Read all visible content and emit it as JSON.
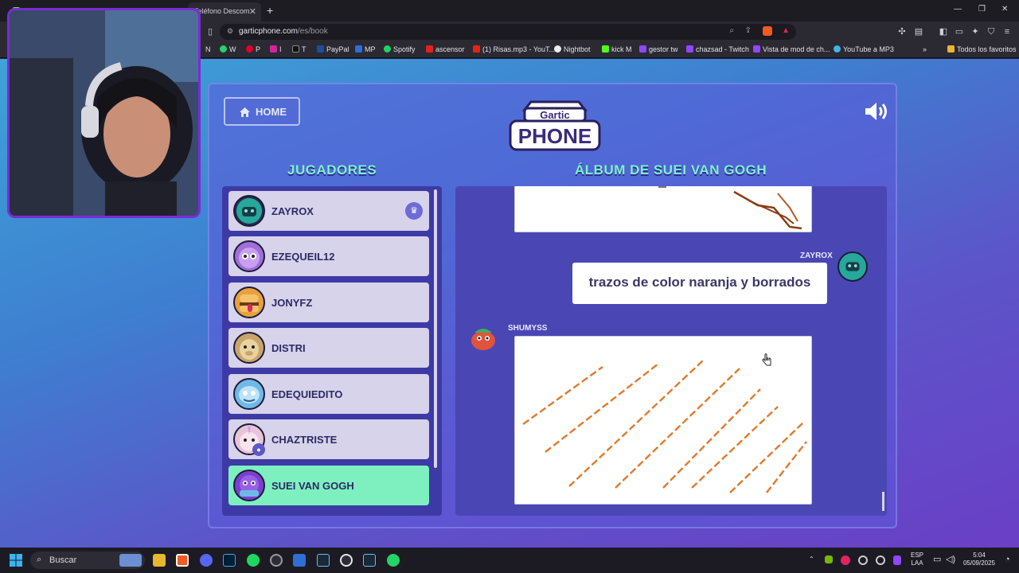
{
  "browser": {
    "tab_label": "Teléfono Descom",
    "url_domain": "garticphone.com",
    "url_path": "/es/book",
    "bookmarks": [
      {
        "label": "N"
      },
      {
        "label": "W"
      },
      {
        "label": "P"
      },
      {
        "label": "I"
      },
      {
        "label": "T"
      },
      {
        "label": "PayPal"
      },
      {
        "label": "MP"
      },
      {
        "label": "Spotify"
      },
      {
        "label": "ascensor"
      },
      {
        "label": "(1) Risas.mp3 - YouT..."
      },
      {
        "label": "Nightbot"
      },
      {
        "label": "kick M"
      },
      {
        "label": "gestor tw"
      },
      {
        "label": "chazsad - Twitch"
      },
      {
        "label": "Vista de mod de ch..."
      },
      {
        "label": "YouTube a MP3"
      },
      {
        "label": "Todos los favoritos"
      }
    ]
  },
  "game": {
    "home_label": "HOME",
    "logo_top": "Gartic",
    "logo_main": "PHONE",
    "players_title": "JUGADORES",
    "album_title": "ÁLBUM DE SUEI VAN GOGH",
    "players": [
      {
        "name": "ZAYROX",
        "host": true,
        "color": "#26a89a"
      },
      {
        "name": "EZEQUEIL12",
        "color": "#a06fd8"
      },
      {
        "name": "JONYFZ",
        "color": "#e9a13b"
      },
      {
        "name": "DISTRI",
        "color": "#c9a56b"
      },
      {
        "name": "EDEQUIEDITO",
        "color": "#6fb9e8"
      },
      {
        "name": "CHAZTRISTE",
        "color": "#e8c4d8"
      },
      {
        "name": "SUEI VAN GOGH",
        "active": true,
        "color": "#7a3fd0"
      }
    ],
    "album": {
      "entry1_author": "ZAYROX",
      "entry1_text": "trazos de color naranja y borrados",
      "entry2_author": "SHUMYSS"
    }
  },
  "taskbar": {
    "search_label": "Buscar",
    "lang_line1": "ESP",
    "lang_line2": "LAA",
    "time": "5:04",
    "date": "05/09/2025"
  },
  "colors": {
    "accent_green": "#7ef0c0",
    "title_mint": "#7ff0cf",
    "stroke_orange": "#e07a2c"
  }
}
